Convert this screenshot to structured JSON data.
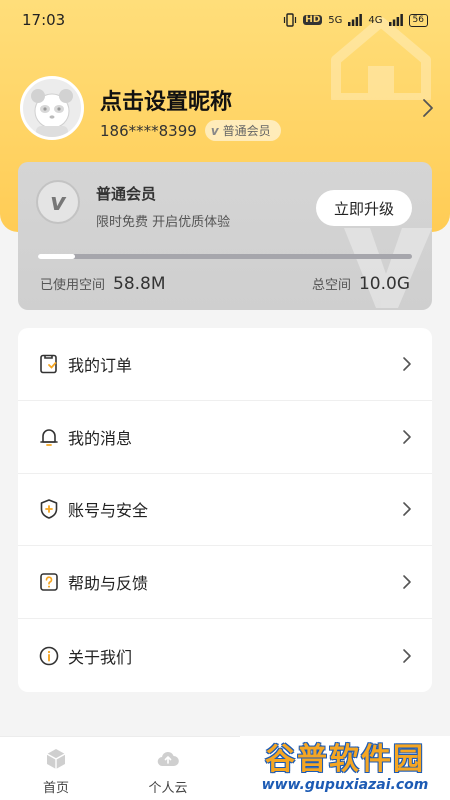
{
  "status_bar": {
    "time": "17:03",
    "hd_tag": "HD",
    "net_5g": "5G",
    "net_4g": "4G",
    "battery": "56"
  },
  "profile": {
    "nickname": "点击设置昵称",
    "phone": "186****8399",
    "member_badge": "普通会员",
    "badge_logo": "v"
  },
  "member_card": {
    "logo": "v",
    "title": "普通会员",
    "subtitle": "限时免费  开启优质体验",
    "upgrade_label": "立即升级",
    "used_label": "已使用空间",
    "used_value": "58.8M",
    "total_label": "总空间",
    "total_value": "10.0G",
    "usage_fraction": 0.1
  },
  "menu": {
    "items": [
      {
        "label": "我的订单",
        "icon": "order-icon"
      },
      {
        "label": "我的消息",
        "icon": "bell-icon"
      },
      {
        "label": "账号与安全",
        "icon": "shield-plus-icon"
      },
      {
        "label": "帮助与反馈",
        "icon": "help-icon"
      },
      {
        "label": "关于我们",
        "icon": "info-icon"
      }
    ]
  },
  "tabbar": {
    "tabs": [
      {
        "label": "首页",
        "icon": "cube-icon"
      },
      {
        "label": "个人云",
        "icon": "cloud-upload-icon"
      }
    ]
  },
  "watermark": {
    "title": "谷普软件园",
    "url": "www.gupuxiazai.com"
  },
  "colors": {
    "hero_yellow": "#ffcc55",
    "accent_orange": "#f5a623",
    "card_gray": "#d2d2d2"
  }
}
